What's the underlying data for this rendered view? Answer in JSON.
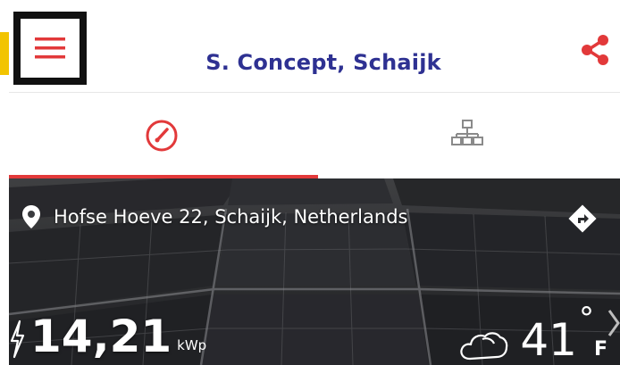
{
  "header": {
    "title": "S. Concept, Schaijk"
  },
  "tabs": [
    {
      "id": "dashboard",
      "icon": "gauge-icon",
      "active": true
    },
    {
      "id": "structure",
      "icon": "hierarchy-icon",
      "active": false
    }
  ],
  "location": {
    "address": "Hofse Hoeve 22, Schaijk, Netherlands"
  },
  "power": {
    "value": "14,21",
    "unit": "kWp"
  },
  "weather": {
    "temperature": "41",
    "degree_symbol": "°",
    "unit": "F",
    "icon": "cloud-icon"
  },
  "colors": {
    "accent": "#e2393a",
    "title": "#2e3192",
    "frame": "#111111",
    "yellow": "#f2c400"
  }
}
